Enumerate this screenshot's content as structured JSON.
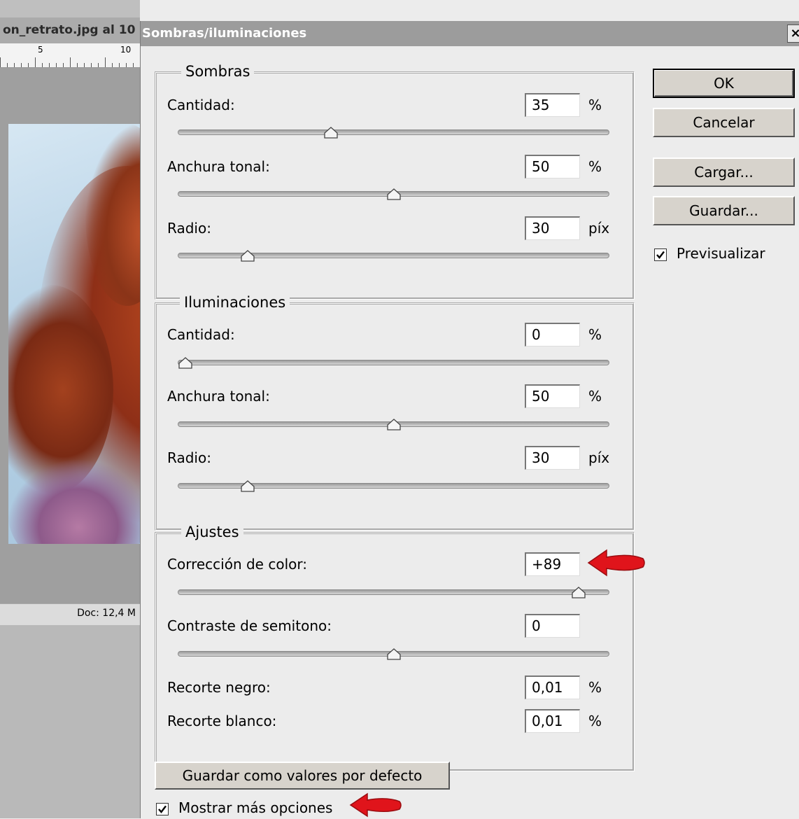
{
  "background_window": {
    "title": "on_retrato.jpg al 10",
    "ruler_labels": [
      "5",
      "10"
    ],
    "status": "Doc: 12,4 M"
  },
  "dialog": {
    "title": "Sombras/iluminaciones",
    "close": "×",
    "sombras": {
      "legend": "Sombras",
      "cantidad": {
        "label": "Cantidad:",
        "value": "35",
        "unit": "%",
        "slider": 0.35
      },
      "anchura": {
        "label": "Anchura tonal:",
        "value": "50",
        "unit": "%",
        "slider": 0.5
      },
      "radio": {
        "label": "Radio:",
        "value": "30",
        "unit": "píx",
        "slider": 0.15
      }
    },
    "iluminaciones": {
      "legend": "Iluminaciones",
      "cantidad": {
        "label": "Cantidad:",
        "value": "0",
        "unit": "%",
        "slider": 0.0
      },
      "anchura": {
        "label": "Anchura tonal:",
        "value": "50",
        "unit": "%",
        "slider": 0.5
      },
      "radio": {
        "label": "Radio:",
        "value": "30",
        "unit": "píx",
        "slider": 0.15
      }
    },
    "ajustes": {
      "legend": "Ajustes",
      "color": {
        "label": "Corrección de color:",
        "value": "+89",
        "slider": 0.945
      },
      "contraste": {
        "label": "Contraste de semitono:",
        "value": "0",
        "slider": 0.5
      },
      "negro": {
        "label": "Recorte negro:",
        "value": "0,01",
        "unit": "%"
      },
      "blanco": {
        "label": "Recorte blanco:",
        "value": "0,01",
        "unit": "%"
      }
    },
    "buttons": {
      "ok": "OK",
      "cancel": "Cancelar",
      "load": "Cargar...",
      "save": "Guardar...",
      "defaults": "Guardar como valores por defecto"
    },
    "preview": {
      "label": "Previsualizar",
      "checked": true
    },
    "more_options": {
      "label": "Mostrar más opciones",
      "checked": true
    }
  },
  "colors": {
    "arrow": "#e0141b",
    "title_bar": "#9c9c9c"
  }
}
